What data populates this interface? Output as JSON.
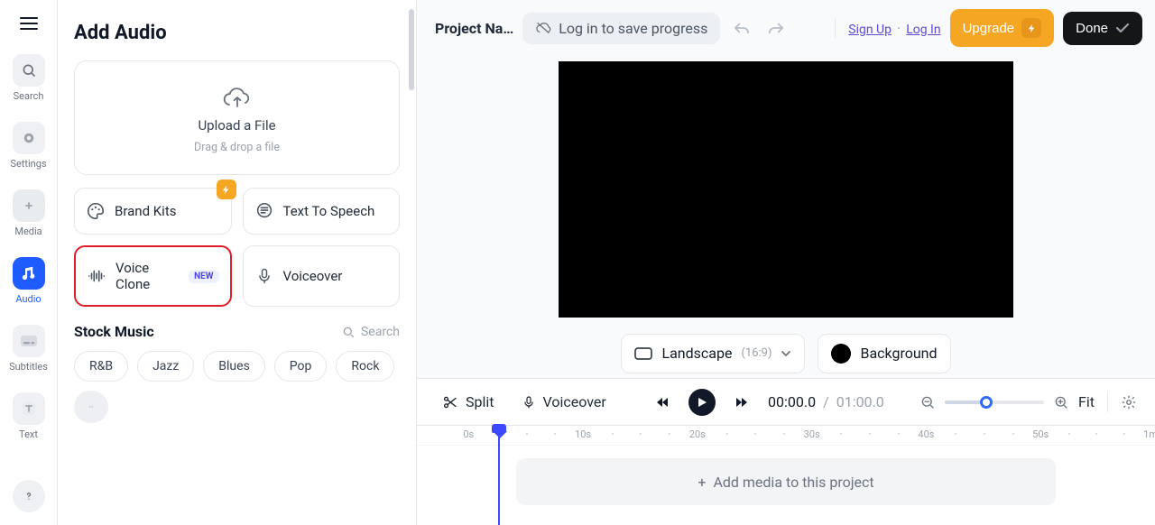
{
  "rail": {
    "items": [
      {
        "id": "search",
        "label": "Search"
      },
      {
        "id": "settings",
        "label": "Settings"
      },
      {
        "id": "media",
        "label": "Media"
      },
      {
        "id": "audio",
        "label": "Audio",
        "active": true
      },
      {
        "id": "subtitles",
        "label": "Subtitles"
      },
      {
        "id": "text",
        "label": "Text"
      }
    ]
  },
  "panel": {
    "title": "Add Audio",
    "upload": {
      "title": "Upload a File",
      "subtitle": "Drag & drop a file"
    },
    "cards": {
      "brand_kits": {
        "label": "Brand Kits",
        "has_bolt": true
      },
      "tts": {
        "label": "Text To Speech"
      },
      "voice_clone": {
        "label": "Voice Clone",
        "pill": "NEW",
        "highlight": true
      },
      "voiceover": {
        "label": "Voiceover"
      }
    },
    "stock": {
      "title": "Stock Music",
      "search_label": "Search",
      "genres": [
        "R&B",
        "Jazz",
        "Blues",
        "Pop",
        "Rock"
      ]
    }
  },
  "top": {
    "project_name": "Project Na…",
    "login_hint": "Log in to save progress",
    "sign_up": "Sign Up",
    "log_in": "Log In",
    "upgrade": "Upgrade",
    "done": "Done"
  },
  "canvas": {
    "aspect_label": "Landscape",
    "aspect_ratio": "(16:9)",
    "background_label": "Background",
    "background_color": "#000000"
  },
  "toolbar": {
    "split": "Split",
    "voiceover": "Voiceover",
    "current": "00:00.0",
    "duration": "01:00.0",
    "fit": "Fit"
  },
  "timeline": {
    "ruler": [
      {
        "label": "0s",
        "pct": 7
      },
      {
        "label": "10s",
        "pct": 22.5
      },
      {
        "label": "20s",
        "pct": 38
      },
      {
        "label": "30s",
        "pct": 53.5
      },
      {
        "label": "40s",
        "pct": 69
      },
      {
        "label": "50s",
        "pct": 84.5
      },
      {
        "label": "1m",
        "pct": 99.4
      }
    ],
    "add_media": "Add media to this project"
  },
  "colors": {
    "accent": "#2663ff",
    "orange": "#f5a623",
    "black": "#111827"
  }
}
